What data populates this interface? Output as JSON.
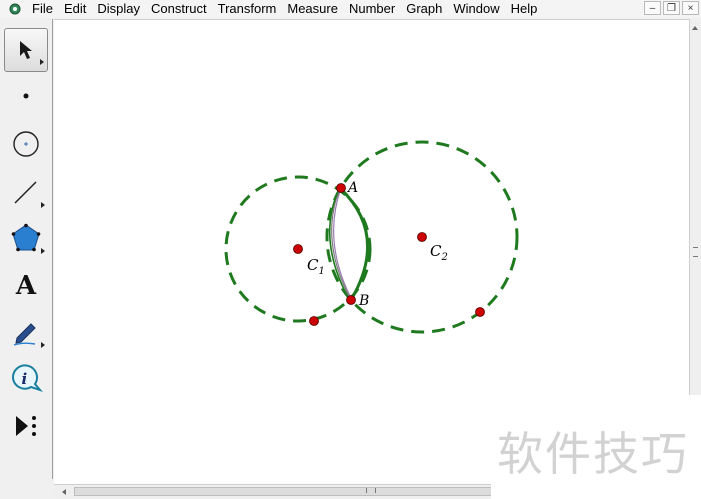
{
  "menu": {
    "items": [
      "File",
      "Edit",
      "Display",
      "Construct",
      "Transform",
      "Measure",
      "Number",
      "Graph",
      "Window",
      "Help"
    ]
  },
  "window_controls": {
    "minimize": "–",
    "restore": "❐",
    "close": "×"
  },
  "toolbox": {
    "tools": [
      {
        "name": "arrow-select-tool",
        "icon": "arrow-icon",
        "active": true
      },
      {
        "name": "point-tool",
        "icon": "point-icon"
      },
      {
        "name": "compass-tool",
        "icon": "compass-circle-icon"
      },
      {
        "name": "straightedge-tool",
        "icon": "segment-icon"
      },
      {
        "name": "polygon-tool",
        "icon": "pentagon-icon"
      },
      {
        "name": "text-tool",
        "icon": "letter-a-icon",
        "glyph": "A"
      },
      {
        "name": "marker-tool",
        "icon": "pen-icon"
      },
      {
        "name": "information-tool",
        "icon": "info-icon",
        "glyph": "i"
      },
      {
        "name": "custom-tool",
        "icon": "play-more-icon"
      }
    ]
  },
  "canvas": {
    "labels": {
      "point_a": "A",
      "point_b": "B",
      "circle1": "C",
      "circle1_sub": "1",
      "circle2": "C",
      "circle2_sub": "2"
    },
    "colors": {
      "circle": "#1f7a1f",
      "point": "#cc0000",
      "arc_purple": "#9a7fb0",
      "arc_gray": "#7a7a7a"
    }
  },
  "watermark": {
    "text": "软件技巧"
  }
}
